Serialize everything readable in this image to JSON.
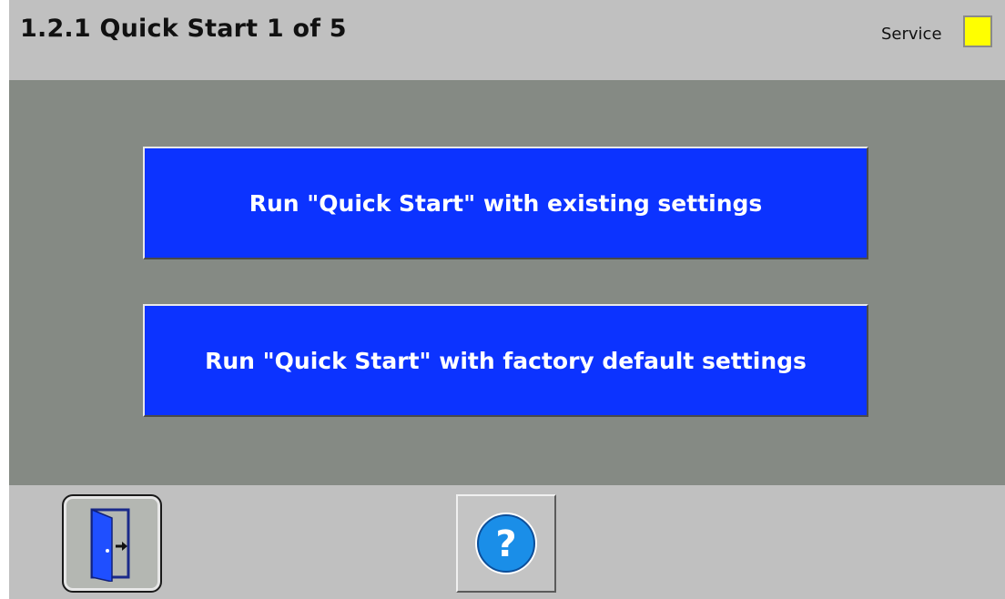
{
  "header": {
    "title": "1.2.1  Quick Start 1 of 5",
    "service_label": "Service",
    "service_color": "#ffff00"
  },
  "main": {
    "buttons": [
      {
        "label": "Run \"Quick Start\" with existing settings",
        "color": "#0c33ff"
      },
      {
        "label": "Run \"Quick Start\" with factory default settings",
        "color": "#0c33ff"
      }
    ]
  },
  "footer": {
    "exit_icon": "exit-door-icon",
    "help_icon": "help-question-icon",
    "help_glyph": "?"
  }
}
